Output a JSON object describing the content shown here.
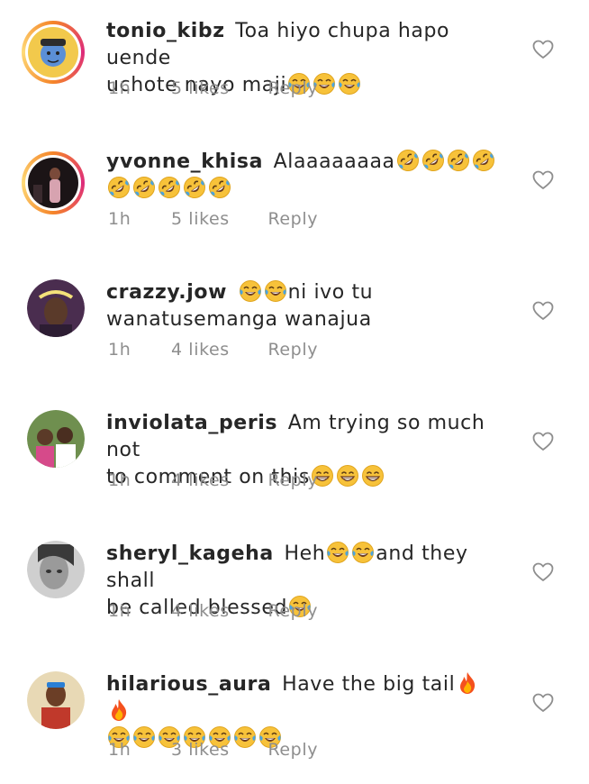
{
  "comments": [
    {
      "username": "tonio_kibz",
      "text_line1": "Toa hiyo chupa hapo uende",
      "text_line2": "uchote nayo maji",
      "emoji_line1": [],
      "emoji_line2": [
        "joy",
        "joy",
        "joy"
      ],
      "time": "1h",
      "likes": "5 likes",
      "reply": "Reply"
    },
    {
      "username": "yvonne_khisa",
      "text_line1": "Alaaaaaaaa",
      "text_line2": "",
      "emoji_line1": [
        "rofl",
        "rofl",
        "rofl",
        "rofl"
      ],
      "emoji_line2": [
        "rofl",
        "rofl",
        "rofl",
        "rofl",
        "rofl"
      ],
      "time": "1h",
      "likes": "5 likes",
      "reply": "Reply"
    },
    {
      "username": "crazzy.jow",
      "text_line1": "ni ivo tu",
      "text_line2": "wanatusemanga wanajua",
      "emoji_line1_before": [
        "joy",
        "joy"
      ],
      "time": "1h",
      "likes": "4 likes",
      "reply": "Reply"
    },
    {
      "username": "inviolata_peris",
      "text_line1": "Am trying so much not",
      "text_line2": "to comment on this",
      "emoji_line2": [
        "grin",
        "grin",
        "grin"
      ],
      "time": "1h",
      "likes": "4 likes",
      "reply": "Reply"
    },
    {
      "username": "sheryl_kageha",
      "text_line1a": "Heh",
      "text_line1b": "and they shall",
      "text_line2": "be called blessed",
      "emoji_mid": [
        "joy",
        "joy"
      ],
      "emoji_line2": [
        "joy"
      ],
      "time": "1h",
      "likes": "4 likes",
      "reply": "Reply"
    },
    {
      "username": "hilarious_aura",
      "text_line1": "Have the  big tail",
      "emoji_line1": [
        "fire",
        "fire"
      ],
      "emoji_line2": [
        "joy",
        "joy",
        "joy",
        "joy",
        "joy",
        "joy",
        "joy"
      ],
      "time": "1h",
      "likes": "3 likes",
      "reply": "Reply"
    }
  ],
  "icons": {
    "like": "heart-outline-icon",
    "joy": "face-with-tears-of-joy-emoji",
    "rofl": "rolling-on-floor-laughing-emoji",
    "grin": "grinning-face-with-smiling-eyes-emoji",
    "fire": "fire-emoji"
  },
  "colors": {
    "text": "#262626",
    "meta": "#8e8e8e",
    "ring_start": "#f58529",
    "ring_end": "#dd2a7b",
    "emoji_yellow": "#f5c33b"
  }
}
